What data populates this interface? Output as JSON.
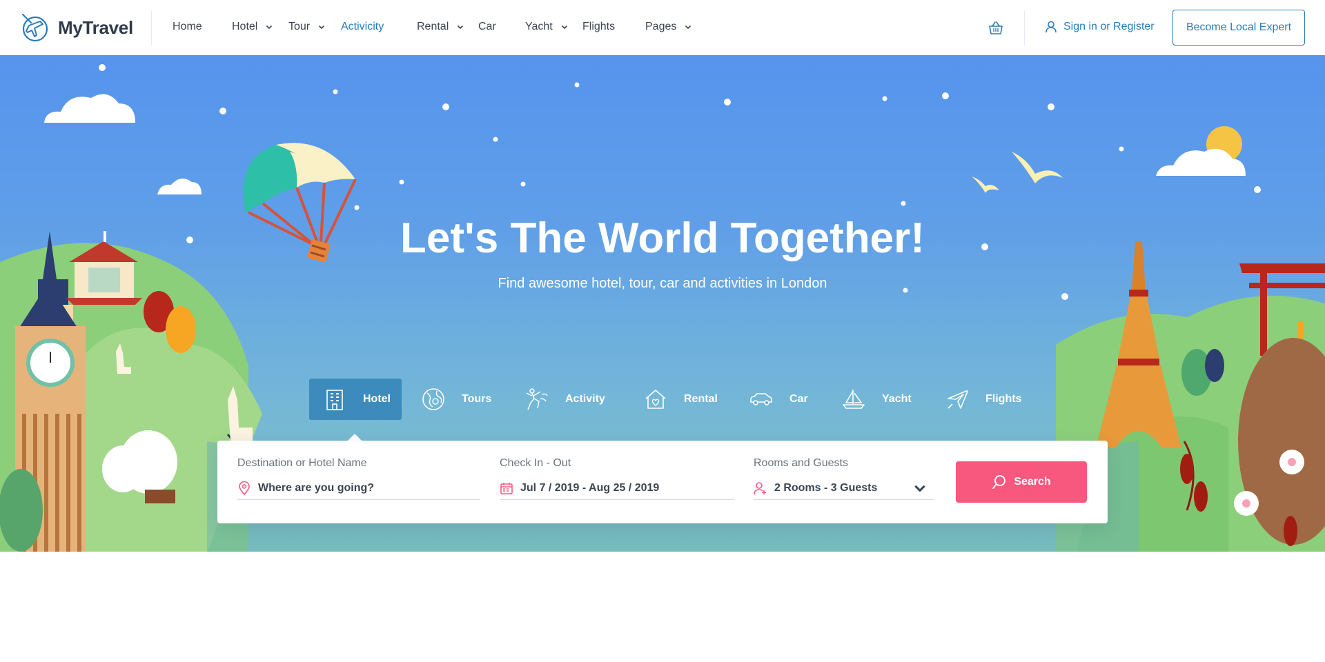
{
  "brand": {
    "name": "MyTravel",
    "primary": "#297cbb",
    "accent": "#f8587d"
  },
  "nav": {
    "items": [
      {
        "label": "Home",
        "dropdown": false
      },
      {
        "label": "Hotel",
        "dropdown": true
      },
      {
        "label": "Tour",
        "dropdown": true
      },
      {
        "label": "Activicity",
        "dropdown": false,
        "active": true
      },
      {
        "label": "Rental",
        "dropdown": true
      },
      {
        "label": "Car",
        "dropdown": false
      },
      {
        "label": "Yacht",
        "dropdown": true
      },
      {
        "label": "Flights",
        "dropdown": false
      },
      {
        "label": "Pages",
        "dropdown": true
      }
    ],
    "cart_icon": "basket-icon",
    "signin_label": "Sign in or Register",
    "expert_button": "Become Local Expert"
  },
  "hero": {
    "title": "Let's The World Together!",
    "subtitle": "Find awesome hotel, tour, car and activities in London"
  },
  "tabs": [
    {
      "label": "Hotel",
      "icon": "hotel-building-icon",
      "active": true
    },
    {
      "label": "Tours",
      "icon": "globe-tour-icon"
    },
    {
      "label": "Activity",
      "icon": "activity-climber-icon"
    },
    {
      "label": "Rental",
      "icon": "rental-house-icon"
    },
    {
      "label": "Car",
      "icon": "car-icon"
    },
    {
      "label": "Yacht",
      "icon": "yacht-icon"
    },
    {
      "label": "Flights",
      "icon": "airplane-icon"
    }
  ],
  "search": {
    "destination": {
      "label": "Destination or Hotel Name",
      "value": "Where are you going?"
    },
    "dates": {
      "label": "Check In - Out",
      "value": "Jul 7 / 2019 - Aug 25 / 2019"
    },
    "guests": {
      "label": "Rooms and Guests",
      "value": "2 Rooms - 3 Guests"
    },
    "button": "Search"
  }
}
